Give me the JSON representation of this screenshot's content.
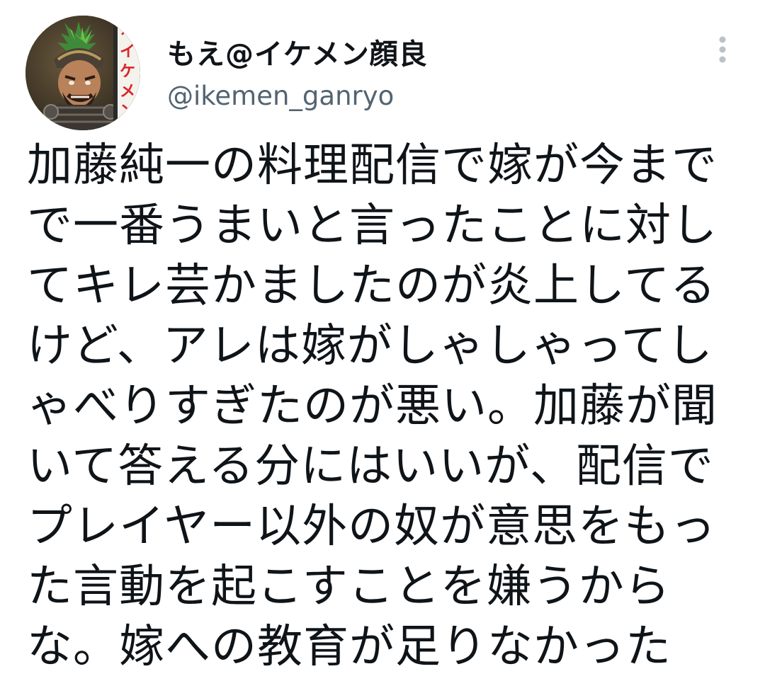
{
  "author": {
    "display_name": "もえ@イケメン顔良",
    "handle": "@ikemen_ganryo",
    "avatar_banner_text": "イケメン"
  },
  "menu": {
    "icon": "more-vertical-icon"
  },
  "tweet": {
    "lines": [
      "加藤純一の料理配信で嫁が今まで",
      "で一番うまいと言ったことに対し",
      "てキレ芸かましたのが炎上してる",
      "けど、アレは嫁がしゃしゃってし",
      "ゃべりすぎたのが悪い。加藤が聞",
      "いて答える分にはいいが、配信で",
      "プレイヤー以外の奴が意思をもっ",
      "た言動を起こすことを嫌うから",
      "な。嫁への教育が足りなかった"
    ]
  },
  "colors": {
    "text_primary": "#0f1419",
    "text_secondary": "#536471",
    "menu_dots": "#b9c2c9",
    "background": "#ffffff"
  }
}
